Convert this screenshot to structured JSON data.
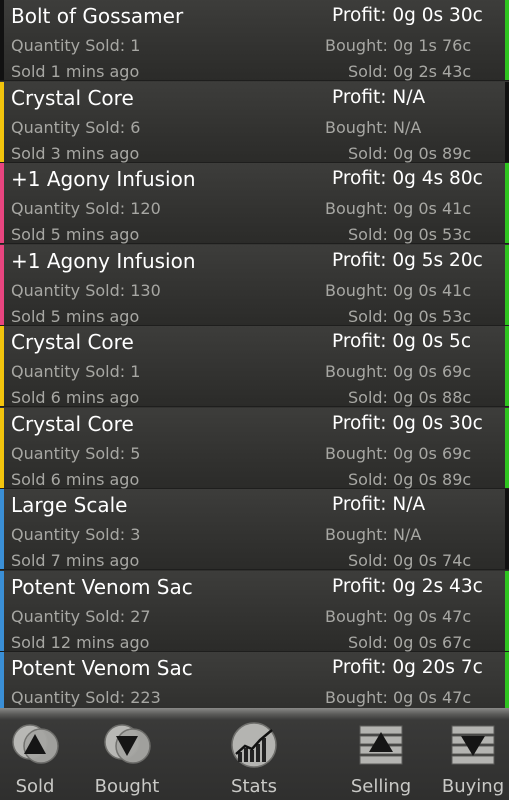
{
  "colors": {
    "gold": "#f2c40d",
    "pink": "#e8457f",
    "green": "#2ec41f",
    "blue": "#3a8fd6",
    "dark": "#111111"
  },
  "rows": [
    {
      "name": "Bolt of Gossamer",
      "qty": "Quantity Sold: 1",
      "ago": "Sold 1 mins ago",
      "profit": "Profit: 0g 0s 30c",
      "bought": "Bought: 0g 1s 76c",
      "sold": "Sold: 0g 2s 43c",
      "left": "dark",
      "right": "green"
    },
    {
      "name": "Crystal Core",
      "qty": "Quantity Sold: 6",
      "ago": "Sold 3 mins ago",
      "profit": "Profit: N/A",
      "bought": "Bought: N/A",
      "sold": "Sold: 0g 0s 89c",
      "left": "gold",
      "right": "dark"
    },
    {
      "name": "+1 Agony Infusion",
      "qty": "Quantity Sold: 120",
      "ago": "Sold 5 mins ago",
      "profit": "Profit: 0g 4s 80c",
      "bought": "Bought: 0g 0s 41c",
      "sold": "Sold: 0g 0s 53c",
      "left": "pink",
      "right": "green"
    },
    {
      "name": "+1 Agony Infusion",
      "qty": "Quantity Sold: 130",
      "ago": "Sold 5 mins ago",
      "profit": "Profit: 0g 5s 20c",
      "bought": "Bought: 0g 0s 41c",
      "sold": "Sold: 0g 0s 53c",
      "left": "pink",
      "right": "green"
    },
    {
      "name": "Crystal Core",
      "qty": "Quantity Sold: 1",
      "ago": "Sold 6 mins ago",
      "profit": "Profit: 0g 0s 5c",
      "bought": "Bought: 0g 0s 69c",
      "sold": "Sold: 0g 0s 88c",
      "left": "gold",
      "right": "green"
    },
    {
      "name": "Crystal Core",
      "qty": "Quantity Sold: 5",
      "ago": "Sold 6 mins ago",
      "profit": "Profit: 0g 0s 30c",
      "bought": "Bought: 0g 0s 69c",
      "sold": "Sold: 0g 0s 89c",
      "left": "gold",
      "right": "green"
    },
    {
      "name": "Large Scale",
      "qty": "Quantity Sold: 3",
      "ago": "Sold 7 mins ago",
      "profit": "Profit: N/A",
      "bought": "Bought: N/A",
      "sold": "Sold: 0g 0s 74c",
      "left": "blue",
      "right": "dark"
    },
    {
      "name": "Potent Venom Sac",
      "qty": "Quantity Sold: 27",
      "ago": "Sold 12 mins ago",
      "profit": "Profit: 0g 2s 43c",
      "bought": "Bought: 0g 0s 47c",
      "sold": "Sold: 0g 0s 67c",
      "left": "blue",
      "right": "green"
    },
    {
      "name": "Potent Venom Sac",
      "qty": "Quantity Sold: 223",
      "ago": "",
      "profit": "Profit: 0g 20s 7c",
      "bought": "Bought: 0g 0s 47c",
      "sold": "",
      "left": "blue",
      "right": "green"
    }
  ],
  "tabs": [
    {
      "label": "Sold",
      "icon": "sold-icon"
    },
    {
      "label": "Bought",
      "icon": "bought-icon"
    },
    {
      "label": "Stats",
      "icon": "stats-icon"
    },
    {
      "label": "Selling",
      "icon": "selling-icon"
    },
    {
      "label": "Buying",
      "icon": "buying-icon"
    }
  ]
}
